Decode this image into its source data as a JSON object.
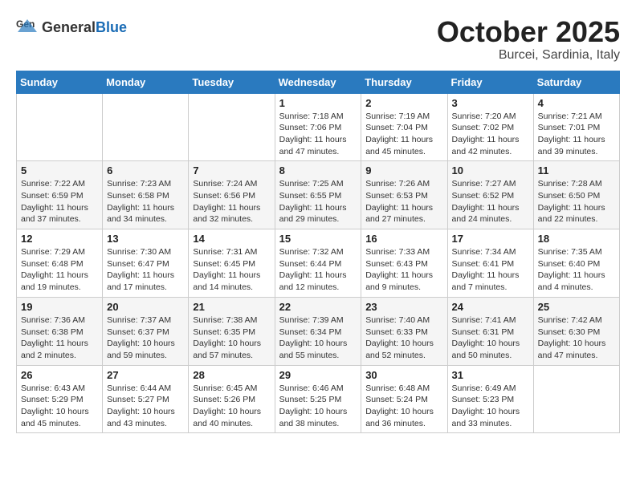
{
  "logo": {
    "text_general": "General",
    "text_blue": "Blue"
  },
  "header": {
    "month_year": "October 2025",
    "location": "Burcei, Sardinia, Italy"
  },
  "weekdays": [
    "Sunday",
    "Monday",
    "Tuesday",
    "Wednesday",
    "Thursday",
    "Friday",
    "Saturday"
  ],
  "weeks": [
    [
      {
        "day": "",
        "info": ""
      },
      {
        "day": "",
        "info": ""
      },
      {
        "day": "",
        "info": ""
      },
      {
        "day": "1",
        "info": "Sunrise: 7:18 AM\nSunset: 7:06 PM\nDaylight: 11 hours and 47 minutes."
      },
      {
        "day": "2",
        "info": "Sunrise: 7:19 AM\nSunset: 7:04 PM\nDaylight: 11 hours and 45 minutes."
      },
      {
        "day": "3",
        "info": "Sunrise: 7:20 AM\nSunset: 7:02 PM\nDaylight: 11 hours and 42 minutes."
      },
      {
        "day": "4",
        "info": "Sunrise: 7:21 AM\nSunset: 7:01 PM\nDaylight: 11 hours and 39 minutes."
      }
    ],
    [
      {
        "day": "5",
        "info": "Sunrise: 7:22 AM\nSunset: 6:59 PM\nDaylight: 11 hours and 37 minutes."
      },
      {
        "day": "6",
        "info": "Sunrise: 7:23 AM\nSunset: 6:58 PM\nDaylight: 11 hours and 34 minutes."
      },
      {
        "day": "7",
        "info": "Sunrise: 7:24 AM\nSunset: 6:56 PM\nDaylight: 11 hours and 32 minutes."
      },
      {
        "day": "8",
        "info": "Sunrise: 7:25 AM\nSunset: 6:55 PM\nDaylight: 11 hours and 29 minutes."
      },
      {
        "day": "9",
        "info": "Sunrise: 7:26 AM\nSunset: 6:53 PM\nDaylight: 11 hours and 27 minutes."
      },
      {
        "day": "10",
        "info": "Sunrise: 7:27 AM\nSunset: 6:52 PM\nDaylight: 11 hours and 24 minutes."
      },
      {
        "day": "11",
        "info": "Sunrise: 7:28 AM\nSunset: 6:50 PM\nDaylight: 11 hours and 22 minutes."
      }
    ],
    [
      {
        "day": "12",
        "info": "Sunrise: 7:29 AM\nSunset: 6:48 PM\nDaylight: 11 hours and 19 minutes."
      },
      {
        "day": "13",
        "info": "Sunrise: 7:30 AM\nSunset: 6:47 PM\nDaylight: 11 hours and 17 minutes."
      },
      {
        "day": "14",
        "info": "Sunrise: 7:31 AM\nSunset: 6:45 PM\nDaylight: 11 hours and 14 minutes."
      },
      {
        "day": "15",
        "info": "Sunrise: 7:32 AM\nSunset: 6:44 PM\nDaylight: 11 hours and 12 minutes."
      },
      {
        "day": "16",
        "info": "Sunrise: 7:33 AM\nSunset: 6:43 PM\nDaylight: 11 hours and 9 minutes."
      },
      {
        "day": "17",
        "info": "Sunrise: 7:34 AM\nSunset: 6:41 PM\nDaylight: 11 hours and 7 minutes."
      },
      {
        "day": "18",
        "info": "Sunrise: 7:35 AM\nSunset: 6:40 PM\nDaylight: 11 hours and 4 minutes."
      }
    ],
    [
      {
        "day": "19",
        "info": "Sunrise: 7:36 AM\nSunset: 6:38 PM\nDaylight: 11 hours and 2 minutes."
      },
      {
        "day": "20",
        "info": "Sunrise: 7:37 AM\nSunset: 6:37 PM\nDaylight: 10 hours and 59 minutes."
      },
      {
        "day": "21",
        "info": "Sunrise: 7:38 AM\nSunset: 6:35 PM\nDaylight: 10 hours and 57 minutes."
      },
      {
        "day": "22",
        "info": "Sunrise: 7:39 AM\nSunset: 6:34 PM\nDaylight: 10 hours and 55 minutes."
      },
      {
        "day": "23",
        "info": "Sunrise: 7:40 AM\nSunset: 6:33 PM\nDaylight: 10 hours and 52 minutes."
      },
      {
        "day": "24",
        "info": "Sunrise: 7:41 AM\nSunset: 6:31 PM\nDaylight: 10 hours and 50 minutes."
      },
      {
        "day": "25",
        "info": "Sunrise: 7:42 AM\nSunset: 6:30 PM\nDaylight: 10 hours and 47 minutes."
      }
    ],
    [
      {
        "day": "26",
        "info": "Sunrise: 6:43 AM\nSunset: 5:29 PM\nDaylight: 10 hours and 45 minutes."
      },
      {
        "day": "27",
        "info": "Sunrise: 6:44 AM\nSunset: 5:27 PM\nDaylight: 10 hours and 43 minutes."
      },
      {
        "day": "28",
        "info": "Sunrise: 6:45 AM\nSunset: 5:26 PM\nDaylight: 10 hours and 40 minutes."
      },
      {
        "day": "29",
        "info": "Sunrise: 6:46 AM\nSunset: 5:25 PM\nDaylight: 10 hours and 38 minutes."
      },
      {
        "day": "30",
        "info": "Sunrise: 6:48 AM\nSunset: 5:24 PM\nDaylight: 10 hours and 36 minutes."
      },
      {
        "day": "31",
        "info": "Sunrise: 6:49 AM\nSunset: 5:23 PM\nDaylight: 10 hours and 33 minutes."
      },
      {
        "day": "",
        "info": ""
      }
    ]
  ]
}
